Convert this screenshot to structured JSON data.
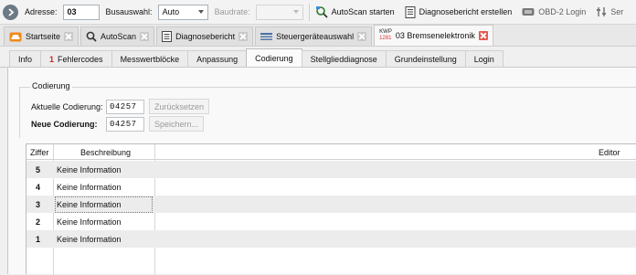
{
  "toolbar": {
    "address_label": "Adresse:",
    "address_value": "03",
    "bus_label": "Busauswahl:",
    "bus_value": "Auto",
    "baud_label": "Baudrate:",
    "baud_value": "",
    "autoscan_label": "AutoScan starten",
    "diag_report_label": "Diagnosebericht erstellen",
    "obd_login_label": "OBD-2 Login",
    "service_label": "Ser"
  },
  "doc_tabs": [
    {
      "label": "Startseite",
      "icon": "car-icon"
    },
    {
      "label": "AutoScan",
      "icon": "magnifier-icon"
    },
    {
      "label": "Diagnosebericht",
      "icon": "report-icon"
    },
    {
      "label": "Steuergeräteauswahl",
      "icon": "list-icon"
    },
    {
      "label": "03 Bremsenelektronik",
      "icon": "kwp-icon",
      "kwp_top": "KWP",
      "kwp_num": "1281"
    }
  ],
  "fn_tabs": [
    {
      "label": "Info"
    },
    {
      "label": "Fehlercodes",
      "badge": "1"
    },
    {
      "label": "Messwertblöcke"
    },
    {
      "label": "Anpassung"
    },
    {
      "label": "Codierung",
      "active": true
    },
    {
      "label": "Stellglieddiagnose"
    },
    {
      "label": "Grundeinstellung"
    },
    {
      "label": "Login"
    }
  ],
  "coding": {
    "group_title": "Codierung",
    "current_label": "Aktuelle Codierung:",
    "current_value": "04257",
    "reset_label": "Zurücksetzen",
    "new_label": "Neue Codierung:",
    "new_value": "04257",
    "save_label": "Speichern..."
  },
  "table": {
    "headers": {
      "digit": "Ziffer",
      "description": "Beschreibung",
      "editor": "Editor"
    },
    "rows": [
      {
        "digit": "5",
        "description": "Keine Information"
      },
      {
        "digit": "4",
        "description": "Keine Information"
      },
      {
        "digit": "3",
        "description": "Keine Information"
      },
      {
        "digit": "2",
        "description": "Keine Information"
      },
      {
        "digit": "1",
        "description": "Keine Information"
      }
    ]
  },
  "colors": {
    "accent_red": "#e25b4f",
    "toolbar_bg": "#f3f3f3",
    "badge_red": "#d22222"
  }
}
